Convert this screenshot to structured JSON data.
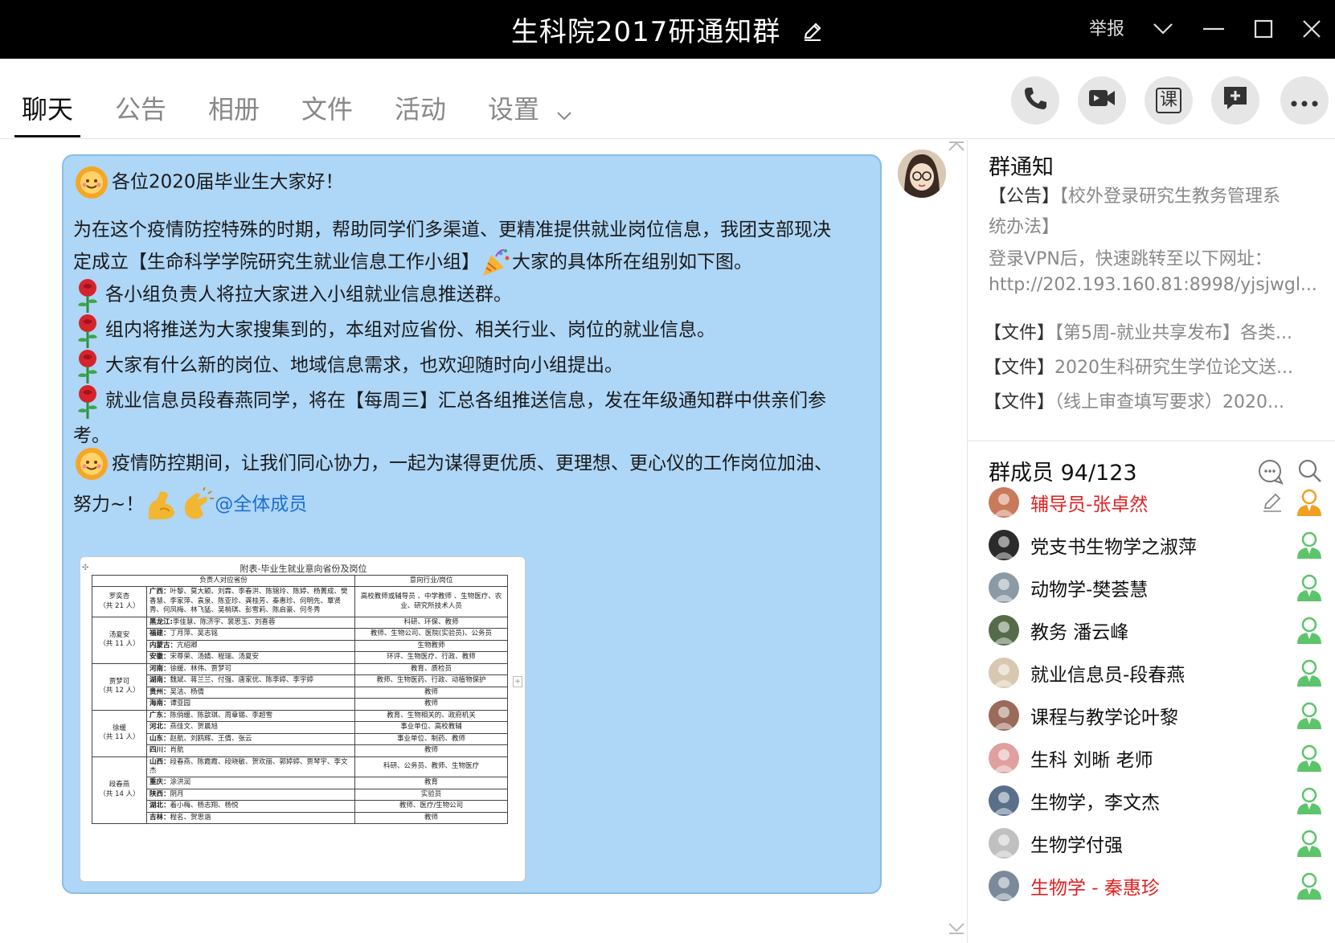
{
  "window": {
    "title": "生科院2017研通知群",
    "report_label": "举报"
  },
  "tabs": [
    {
      "label": "聊天"
    },
    {
      "label": "公告"
    },
    {
      "label": "相册"
    },
    {
      "label": "文件"
    },
    {
      "label": "活动"
    },
    {
      "label": "设置"
    }
  ],
  "toolbar": {
    "class_label": "课"
  },
  "message": {
    "lines": [
      "各位2020届毕业生大家好！",
      "为在这个疫情防控特殊的时期，帮助同学们多渠道、更精准提供就业岗位信息，我团支部现决",
      "定成立【生命科学学院研究生就业信息工作小组】",
      "大家的具体所在组别如下图。",
      "各小组负责人将拉大家进入小组就业信息推送群。",
      "组内将推送为大家搜集到的，本组对应省份、相关行业、岗位的就业信息。",
      "大家有什么新的岗位、地域信息需求，也欢迎随时向小组提出。",
      "就业信息员段春燕同学，将在【每周三】汇总各组推送信息，发在年级通知群中供亲们参",
      "考。",
      "疫情防控期间，让我们同心协力，一起为谋得更优质、更理想、更心仪的工作岗位加油、",
      "努力~！"
    ],
    "mention": "@全体成员"
  },
  "attachment_table": {
    "title": "附表-毕业生就业意向省份及岗位",
    "headers": [
      "负责人对应省份",
      "意向行业/岗位"
    ],
    "groups": [
      {
        "leader": "罗奕杏",
        "count": "（共 21 人）",
        "rows": [
          {
            "region": "广西：",
            "names": "叶黎、莫大颖、刘霖、李春洪、陈锦玲、陈婷、杨菁成、樊香慧、李家萍、袁泉、陈亚珍、龚桂芳、秦惠珍、何明先、覃贤秀、何凤梅、林飞猛、吴梢琪、彭雪莉、陈启豪、何冬秀",
            "jobs": "高校教师或辅导员 、中学教师 、生物医疗、农业、研究所技术人员"
          }
        ]
      },
      {
        "leader": "汤夏安",
        "count": "（共 11 人）",
        "rows": [
          {
            "region": "黑龙江:",
            "names": "李佳慧、陈济宇、裴思玉、刘喜蓉",
            "jobs": "科研、环保、教师"
          },
          {
            "region": "福建：",
            "names": "丁月萍、吴志铭",
            "jobs": "教师、生物公司、医院(实验员)、公务员"
          },
          {
            "region": "内蒙古：",
            "names": "亢绍卿",
            "jobs": "生物教师"
          },
          {
            "region": "安徽：",
            "names": "宋尊荣、汤婧、程瑞、汤夏安",
            "jobs": "环评、生物医疗、行政、教师"
          }
        ]
      },
      {
        "leader": "贾梦可",
        "count": "（共 12 人）",
        "rows": [
          {
            "region": "河南：",
            "names": "徐缓、林伟、贾梦可",
            "jobs": "教育、质检员"
          },
          {
            "region": "湖南：",
            "names": "魏斌、蒋兰兰、付强、唐家优、陈李婷、李宇婷",
            "jobs": "教师、生物医药、行政、动植物保护"
          },
          {
            "region": "贵州：",
            "names": "吴洁、杨倩",
            "jobs": "教师"
          },
          {
            "region": "海南：",
            "names": "谭亚园",
            "jobs": "教师"
          }
        ]
      },
      {
        "leader": "徐缓",
        "count": "（共 11 人）",
        "rows": [
          {
            "region": "广东：",
            "names": "陈俏缓、陈歆琪、周章锡、李超雪",
            "jobs": "教育、生物相关的、政府机关"
          },
          {
            "region": "河北：",
            "names": "燕佳文、贺晨旭",
            "jobs": "事业单位、高校教辅"
          },
          {
            "region": "山东：",
            "names": "赵航、刘鸥辉、王倩、张云",
            "jobs": "事业单位、制药、教师"
          },
          {
            "region": "四川：",
            "names": "肖航",
            "jobs": "教师"
          }
        ]
      },
      {
        "leader": "段春燕",
        "count": "（共 14 人）",
        "rows": [
          {
            "region": "山西：",
            "names": "段春燕、陈霞霞、段晓敏、贺欢丽、郭婷婷、贾琴宇、李文杰",
            "jobs": "科研、公务员、教师、生物医疗"
          },
          {
            "region": "重庆：",
            "names": "涂洪润",
            "jobs": "教育"
          },
          {
            "region": "陕西：",
            "names": "阴月",
            "jobs": "实验员"
          },
          {
            "region": "湖北：",
            "names": "着小梅、杨志翔、杨悦",
            "jobs": "教师、医疗/生物公司"
          },
          {
            "region": "吉林：",
            "names": "程名、贺思谐",
            "jobs": "教师"
          }
        ]
      }
    ]
  },
  "side": {
    "notice_title": "群通知",
    "notice_lines": [
      {
        "prefix": "【公告】",
        "text": "【校外登录研究生教务管理系"
      },
      {
        "prefix": "",
        "text": "统办法】"
      },
      {
        "prefix": "",
        "text": "登录VPN后，快速跳转至以下网址："
      },
      {
        "prefix": "",
        "text": "http://202.193.160.81:8998/yjsjwgl..."
      }
    ],
    "files": [
      {
        "prefix": "【文件】",
        "text": "【第5周-就业共享发布】各类..."
      },
      {
        "prefix": "【文件】",
        "text": "2020生科研究生学位论文送..."
      },
      {
        "prefix": "【文件】",
        "text": "（线上审查填写要求）2020..."
      }
    ],
    "members_title": "群成员 94/123",
    "members": [
      {
        "name": "辅导员-张卓然",
        "highlight": true,
        "role": "owner"
      },
      {
        "name": "党支书生物学之淑萍",
        "highlight": false,
        "role": "member"
      },
      {
        "name": "动物学-樊荟慧",
        "highlight": false,
        "role": "member"
      },
      {
        "name": "教务  潘云峰",
        "highlight": false,
        "role": "member"
      },
      {
        "name": "就业信息员-段春燕",
        "highlight": false,
        "role": "member"
      },
      {
        "name": "课程与教学论叶黎",
        "highlight": false,
        "role": "member"
      },
      {
        "name": "生科 刘晰 老师",
        "highlight": false,
        "role": "member"
      },
      {
        "name": "生物学，李文杰",
        "highlight": false,
        "role": "member"
      },
      {
        "name": "生物学付强",
        "highlight": false,
        "role": "member"
      },
      {
        "name": "生物学 - 秦惠珍",
        "highlight": true,
        "role": "member"
      }
    ]
  },
  "colors": {
    "bubble": "#aed6f6",
    "mention": "#1d6fd4",
    "highlight_name": "#e02020",
    "owner_icon": "#f0a020",
    "member_icon": "#5cc46a"
  }
}
